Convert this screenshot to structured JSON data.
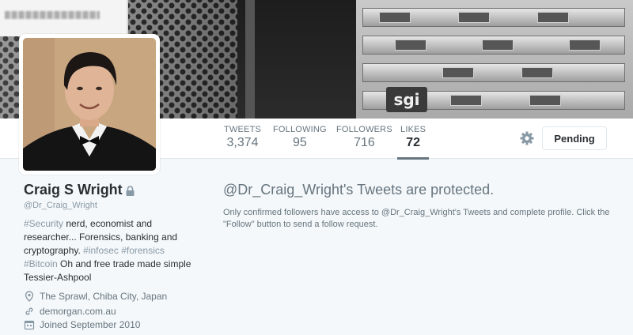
{
  "header": {
    "banner_logo_text": "sgi"
  },
  "nav": {
    "stats": [
      {
        "label": "TWEETS",
        "value": "3,374",
        "active": false
      },
      {
        "label": "FOLLOWING",
        "value": "95",
        "active": false
      },
      {
        "label": "FOLLOWERS",
        "value": "716",
        "active": false
      },
      {
        "label": "LIKES",
        "value": "72",
        "active": true
      }
    ],
    "settings_icon": "gear-icon",
    "pending_label": "Pending"
  },
  "profile": {
    "name": "Craig S Wright",
    "lock_icon": "lock-icon",
    "handle": "@Dr_Craig_Wright",
    "bio": {
      "tag_security": "#Security",
      "line1_rest": " nerd, economist and researcher... Forensics, banking and cryptography. ",
      "tag_infosec": "#infosec",
      "space": " ",
      "tag_forensics": "#forensics",
      "tag_bitcoin": "#Bitcoin",
      "line_end": " Oh and free trade made simple Tessier-Ashpool"
    },
    "location": "The Sprawl, Chiba City, Japan",
    "website": "demorgan.com.au",
    "joined": "Joined September 2010",
    "location_icon": "map-pin-icon",
    "website_icon": "link-icon",
    "joined_icon": "calendar-icon"
  },
  "protected": {
    "title": "@Dr_Craig_Wright's Tweets are protected.",
    "text": "Only confirmed followers have access to @Dr_Craig_Wright's Tweets and complete profile. Click the \"Follow\" button to send a follow request."
  },
  "colors": {
    "background": "#f5f8fa",
    "text": "#292f33",
    "muted": "#66757f",
    "tag": "#8899a6",
    "border": "#e1e8ed"
  }
}
